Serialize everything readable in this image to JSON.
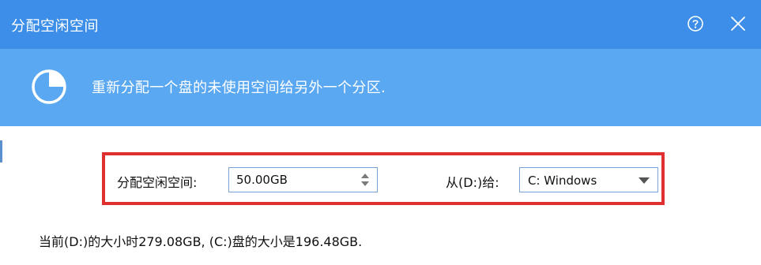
{
  "window": {
    "title": "分配空闲空间",
    "help_icon": "help-circle-icon",
    "close_icon": "close-icon"
  },
  "header": {
    "icon": "pie-chart-icon",
    "description": "重新分配一个盘的未使用空间给另外一个分区."
  },
  "form": {
    "free_space_label": "分配空闲空间:",
    "free_space_value": "50.00GB",
    "from_label": "从(D:)给:",
    "target_value": "C: Windows"
  },
  "info": {
    "text": "当前(D:)的大小时279.08GB, (C:)盘的大小是196.48GB."
  },
  "colors": {
    "titlebar": "#3d8ee8",
    "header": "#59a8f1",
    "highlight_border": "#e02f2f"
  }
}
